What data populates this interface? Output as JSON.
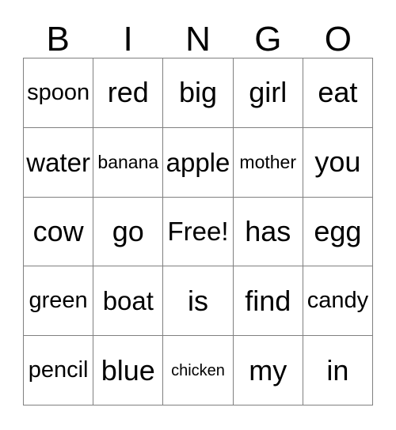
{
  "card": {
    "title": "BINGO",
    "header_letters": [
      "B",
      "I",
      "N",
      "G",
      "O"
    ],
    "grid_size": "5x5",
    "free_space": "Free!",
    "colors": {
      "background": "#ffffff",
      "text": "#000000",
      "grid_line": "#808080"
    },
    "rows": [
      [
        {
          "word": "spoon",
          "size": "size-md"
        },
        {
          "word": "red",
          "size": "size-xl"
        },
        {
          "word": "big",
          "size": "size-xl"
        },
        {
          "word": "girl",
          "size": "size-xl"
        },
        {
          "word": "eat",
          "size": "size-xl"
        }
      ],
      [
        {
          "word": "water",
          "size": "size-lg"
        },
        {
          "word": "banana",
          "size": "size-sm"
        },
        {
          "word": "apple",
          "size": "size-lg"
        },
        {
          "word": "mother",
          "size": "size-sm"
        },
        {
          "word": "you",
          "size": "size-xl"
        }
      ],
      [
        {
          "word": "cow",
          "size": "size-xl"
        },
        {
          "word": "go",
          "size": "size-xl"
        },
        {
          "word": "Free!",
          "size": "size-lg"
        },
        {
          "word": "has",
          "size": "size-xl"
        },
        {
          "word": "egg",
          "size": "size-xl"
        }
      ],
      [
        {
          "word": "green",
          "size": "size-md"
        },
        {
          "word": "boat",
          "size": "size-lg"
        },
        {
          "word": "is",
          "size": "size-xl"
        },
        {
          "word": "find",
          "size": "size-xl"
        },
        {
          "word": "candy",
          "size": "size-md"
        }
      ],
      [
        {
          "word": "pencil",
          "size": "size-md"
        },
        {
          "word": "blue",
          "size": "size-xl"
        },
        {
          "word": "chicken",
          "size": "size-xs"
        },
        {
          "word": "my",
          "size": "size-xl"
        },
        {
          "word": "in",
          "size": "size-xl"
        }
      ]
    ]
  }
}
